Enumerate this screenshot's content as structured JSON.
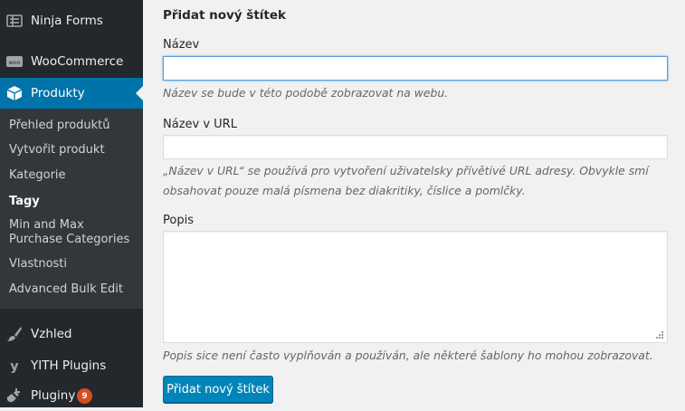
{
  "sidebar": {
    "menu": [
      {
        "label": "Ninja Forms",
        "icon": "ninja-forms-icon"
      },
      {
        "label": "WooCommerce",
        "icon": "woocommerce-icon",
        "icon_text": "woo"
      },
      {
        "label": "Produkty",
        "icon": "products-box-icon",
        "active": true
      },
      {
        "label": "Vzhled",
        "icon": "appearance-brush-icon"
      },
      {
        "label": "YITH Plugins",
        "icon": "yith-icon",
        "icon_text": "y"
      },
      {
        "label": "Pluginy",
        "icon": "plugins-plug-icon",
        "badge": "9"
      }
    ],
    "submenu": [
      {
        "label": "Přehled produktů"
      },
      {
        "label": "Vytvořit produkt"
      },
      {
        "label": "Kategorie"
      },
      {
        "label": "Tagy",
        "current": true
      },
      {
        "label": "Min and Max Purchase Categories"
      },
      {
        "label": "Vlastnosti"
      },
      {
        "label": "Advanced Bulk Edit"
      }
    ]
  },
  "form": {
    "heading": "Přidat nový štítek",
    "name": {
      "label": "Název",
      "value": "",
      "description": "Název se bude v této podobě zobrazovat na webu."
    },
    "slug": {
      "label": "Název v URL",
      "value": "",
      "description": "„Název v URL“ se používá pro vytvoření uživatelsky přívětivé URL adresy. Obvykle smí obsahovat pouze malá písmena bez diakritiky, číslice a pomlčky."
    },
    "description": {
      "label": "Popis",
      "value": "",
      "description": "Popis sice není často vyplňován a používán, ale některé šablony ho mohou zobrazovat."
    },
    "submit_label": "Přidat nový štítek"
  },
  "colors": {
    "sidebar_bg": "#23282d",
    "submenu_bg": "#32373c",
    "active_bg": "#0073aa",
    "button_bg": "#0085ba",
    "badge_bg": "#d54e21"
  }
}
